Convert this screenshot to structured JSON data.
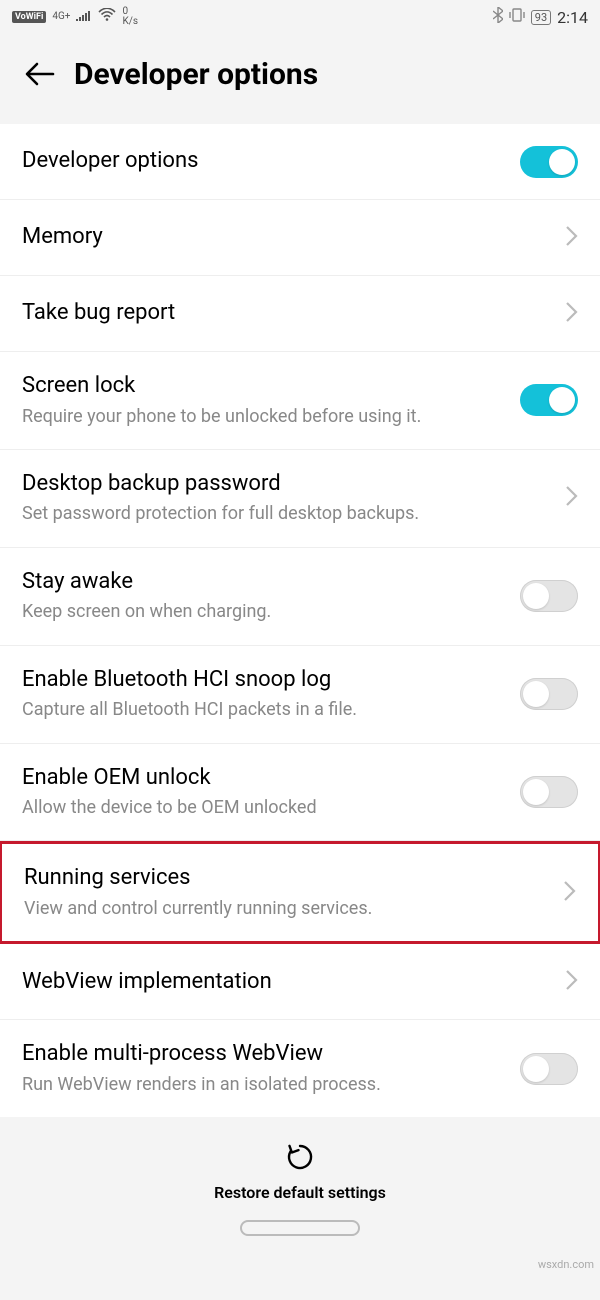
{
  "status": {
    "vowifi": "VoWiFi",
    "network": "4G+",
    "speed_top": "0",
    "speed_bottom": "K/s",
    "battery": "93",
    "time": "2:14"
  },
  "header": {
    "title": "Developer options"
  },
  "rows": {
    "dev_options": {
      "title": "Developer options"
    },
    "memory": {
      "title": "Memory"
    },
    "bug_report": {
      "title": "Take bug report"
    },
    "screen_lock": {
      "title": "Screen lock",
      "sub": "Require your phone to be unlocked before using it."
    },
    "desktop_backup": {
      "title": "Desktop backup password",
      "sub": "Set password protection for full desktop backups."
    },
    "stay_awake": {
      "title": "Stay awake",
      "sub": "Keep screen on when charging."
    },
    "hci_log": {
      "title": "Enable Bluetooth HCI snoop log",
      "sub": "Capture all Bluetooth HCI packets in a file."
    },
    "oem_unlock": {
      "title": "Enable OEM unlock",
      "sub": "Allow the device to be OEM unlocked"
    },
    "running_services": {
      "title": "Running services",
      "sub": "View and control currently running services."
    },
    "webview_impl": {
      "title": "WebView implementation"
    },
    "multi_webview": {
      "title": "Enable multi-process WebView",
      "sub": "Run WebView renders in an isolated process."
    }
  },
  "footer": {
    "restore": "Restore default settings"
  },
  "watermark": "wsxdn.com"
}
